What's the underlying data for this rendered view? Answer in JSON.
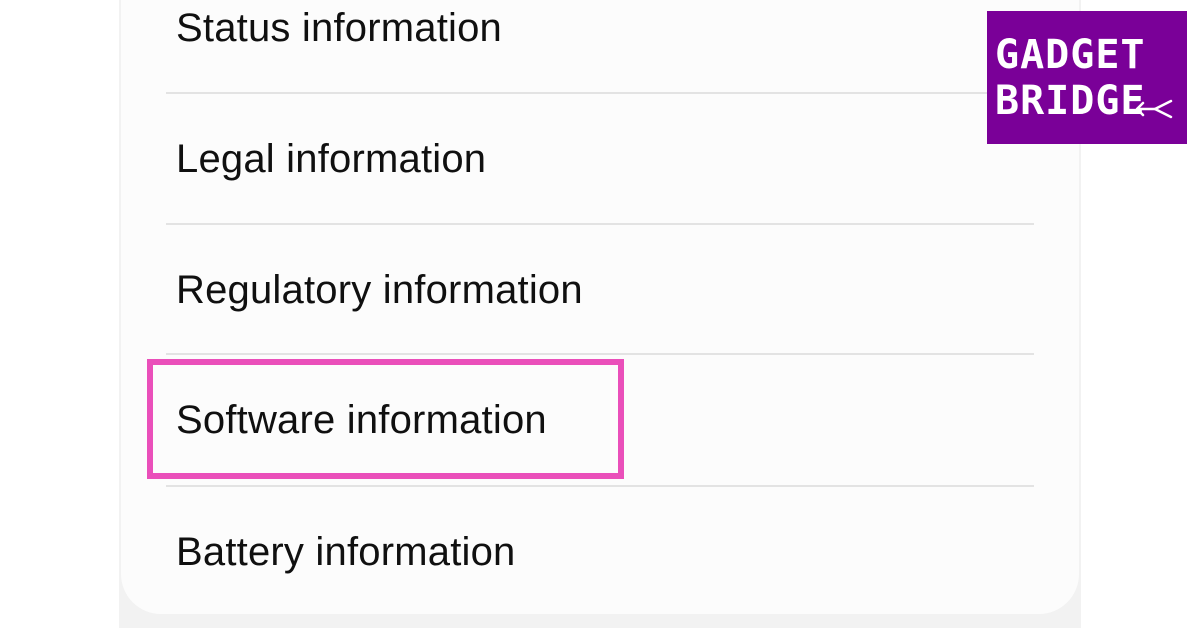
{
  "settings_list": {
    "items": [
      {
        "label": "Status information"
      },
      {
        "label": "Legal information"
      },
      {
        "label": "Regulatory information"
      },
      {
        "label": "Software information",
        "highlighted": true
      },
      {
        "label": "Battery information"
      }
    ]
  },
  "highlight": {
    "color": "#ea4fba"
  },
  "watermark": {
    "line1": "GADGET",
    "line2": "BRIDGE",
    "background": "#7a0098",
    "icon": "arrow-swap-icon"
  }
}
